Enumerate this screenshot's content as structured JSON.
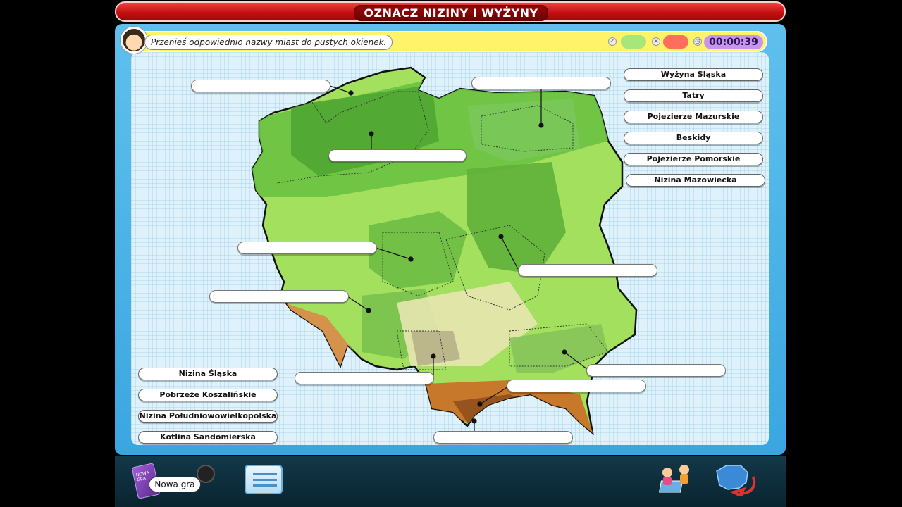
{
  "title": "OZNACZ NIZINY I WYŻYNY",
  "instruction": "Przenieś odpowiednio nazwy miast do pustych okienek.",
  "score": {
    "correct_icon": "check-icon",
    "wrong_icon": "cross-icon",
    "timer_icon": "stopwatch-icon",
    "timer": "00:00:39"
  },
  "labels_right": [
    "Wyżyna Śląska",
    "Tatry",
    "Pojezierze Mazurskie",
    "Beskidy",
    "Pojezierze Pomorskie",
    "Nizina Mazowiecka"
  ],
  "labels_left": [
    "Nizina Śląska",
    "Pobrzeże Koszalińskie",
    "Nizina Południowowielkopolska",
    "Kotlina Sandomierska"
  ],
  "toolbar": {
    "new_game": "Nowa gra",
    "new_game_book_text": "NOWA GRA"
  },
  "colors": {
    "title_red": "#c41010",
    "board_blue": "#3aa6e0",
    "lowland_green": "#8ed85a",
    "upland_green": "#5fb43a",
    "highland_brown": "#c8782a"
  }
}
